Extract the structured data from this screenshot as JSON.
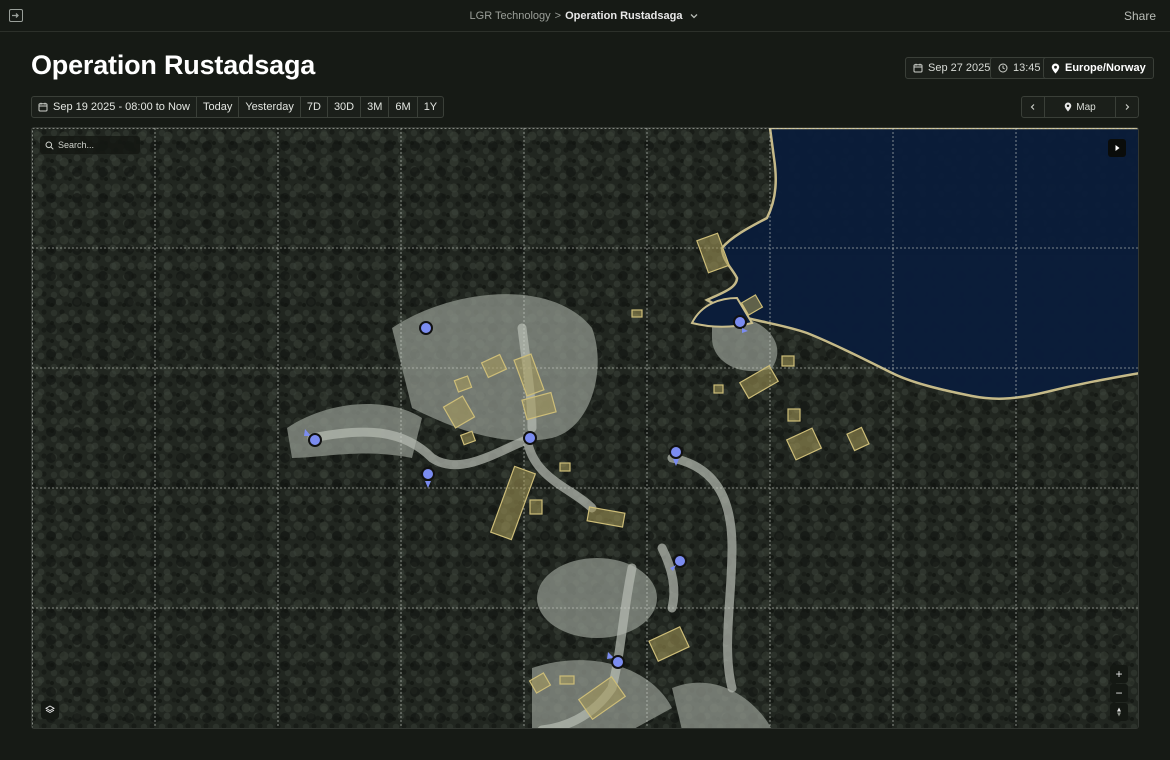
{
  "topbar": {
    "breadcrumb_parent": "LGR Technology",
    "breadcrumb_separator": ">",
    "breadcrumb_current": "Operation Rustadsaga",
    "share_label": "Share"
  },
  "header": {
    "title": "Operation Rustadsaga",
    "date": "Sep 27 2025",
    "time": "13:45",
    "timezone": "Europe/Norway"
  },
  "time_range": {
    "current": "Sep 19 2025 - 08:00 to Now",
    "presets": [
      "Today",
      "Yesterday",
      "7D",
      "30D",
      "3M",
      "6M",
      "1Y"
    ]
  },
  "view_nav": {
    "label": "Map"
  },
  "map": {
    "search_placeholder": "Search...",
    "zoom_in_label": "+",
    "zoom_out_label": "−",
    "markers_count": 8,
    "colors": {
      "water": "#0b1d3a",
      "building_fill": "#a89a5a",
      "building_stroke": "#cdbd78",
      "marker": "#7b8cf0",
      "grid": "#cfd4cc"
    }
  }
}
